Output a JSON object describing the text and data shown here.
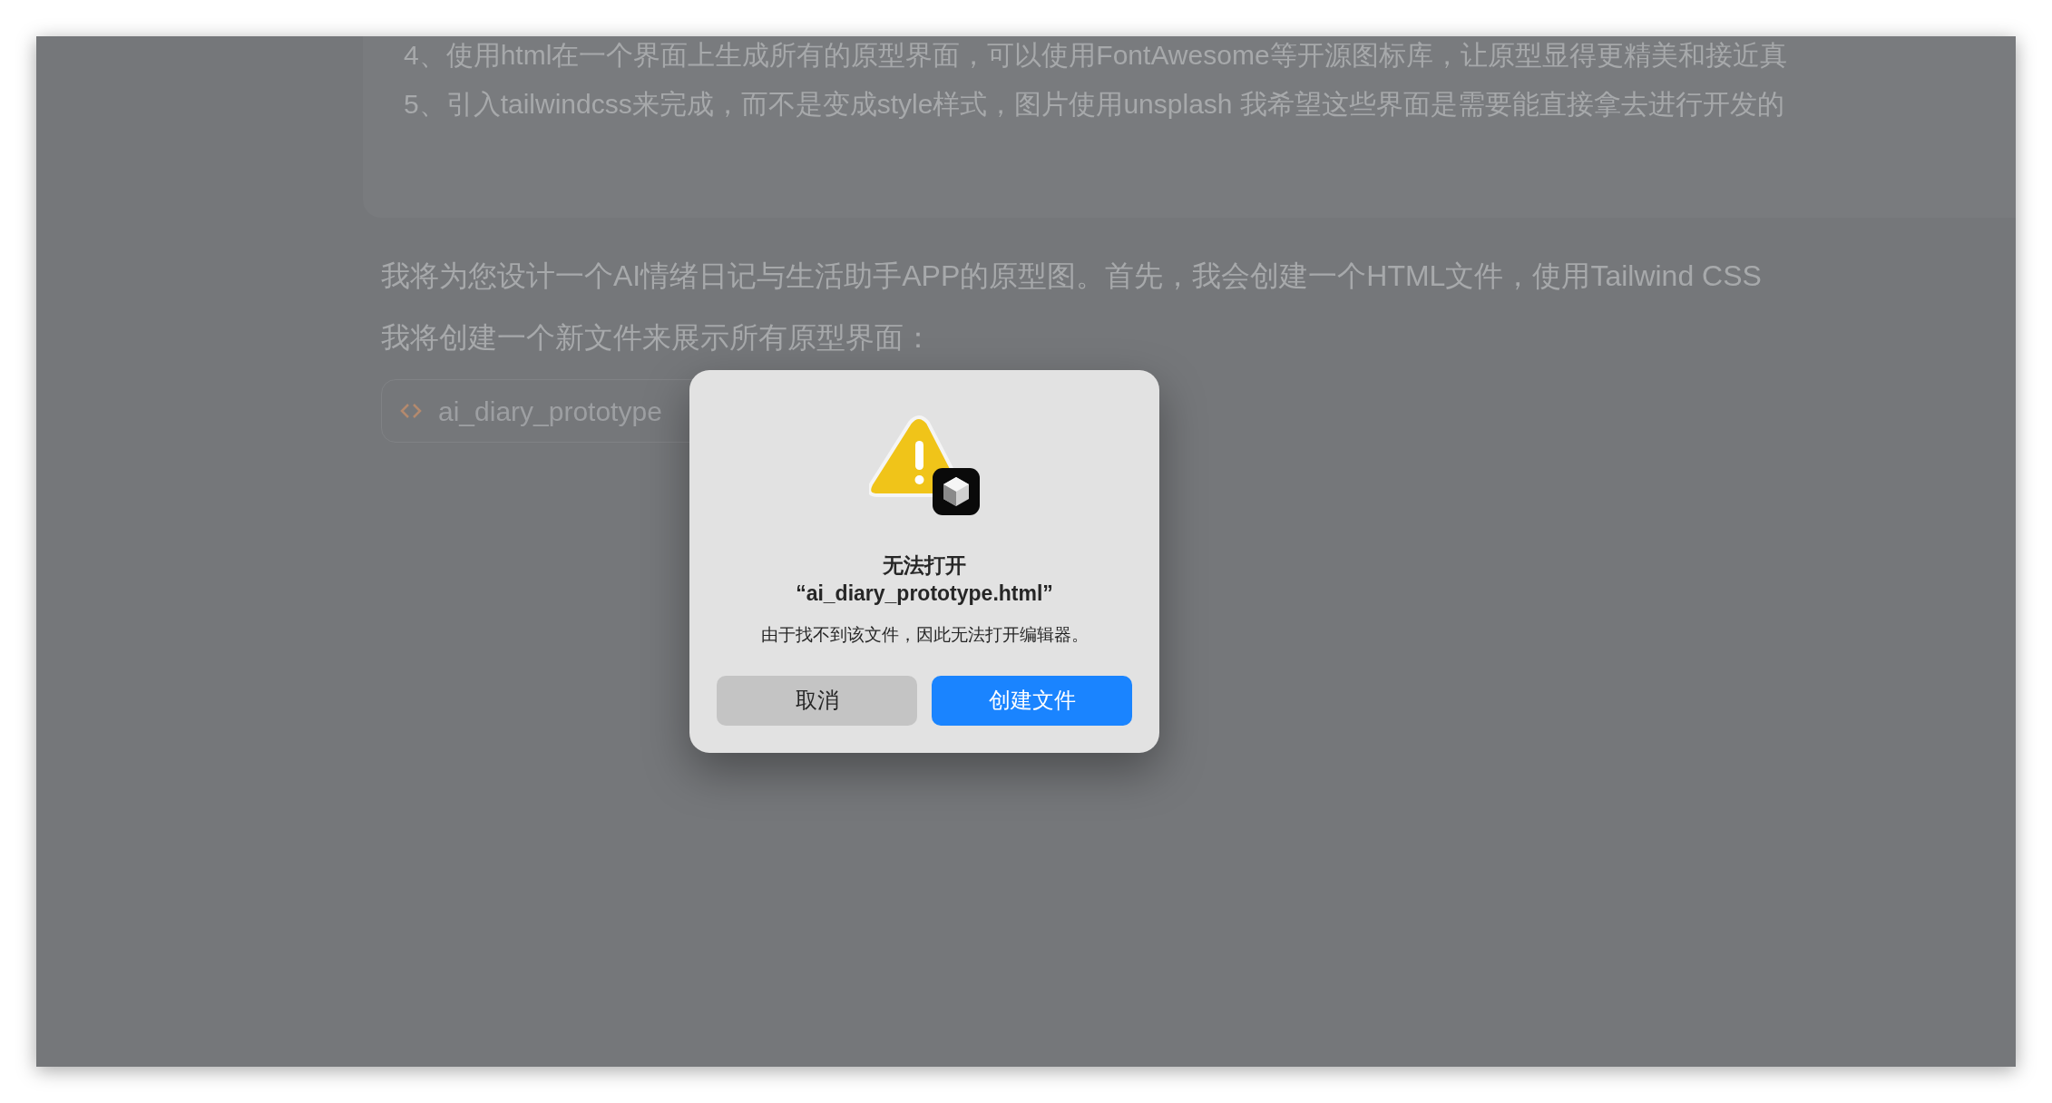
{
  "quoted_request": {
    "lines": [
      "4、使用html在一个界面上生成所有的原型界面，可以使用FontAwesome等开源图标库，让原型显得更精美和接近真",
      "5、引入tailwindcss来完成，而不是变成style样式，图片使用unsplash 我希望这些界面是需要能直接拿去进行开发的"
    ]
  },
  "response": {
    "paragraphs": [
      "我将为您设计一个AI情绪日记与生活助手APP的原型图。首先，我会创建一个HTML文件，使用Tailwind CSS",
      "我将创建一个新文件来展示所有原型界面："
    ]
  },
  "file_chip": {
    "name": "ai_diary_prototype"
  },
  "dialog": {
    "title": "无法打开",
    "filename": "“ai_diary_prototype.html”",
    "message": "由于找不到该文件，因此无法打开编辑器。",
    "buttons": [
      {
        "label": "取消",
        "kind": "secondary"
      },
      {
        "label": "创建文件",
        "kind": "primary"
      }
    ]
  }
}
